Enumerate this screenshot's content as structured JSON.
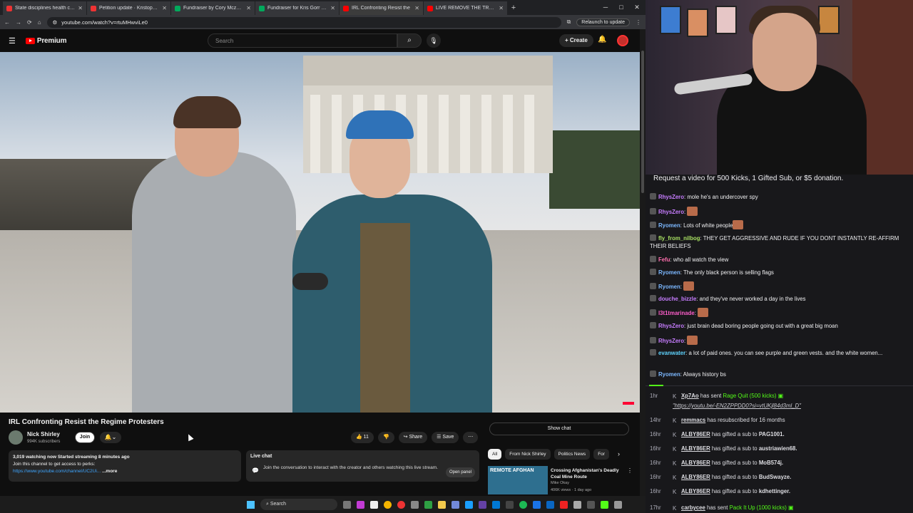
{
  "browser": {
    "tabs": [
      {
        "title": "State disciplines health care pr",
        "color": "#e33"
      },
      {
        "title": "Petition update · Kristopher's s",
        "color": "#e33"
      },
      {
        "title": "Fundraiser by Cory Mczenna : ",
        "color": "#02a95c"
      },
      {
        "title": "Fundraiser for Kris Gorr by Kel",
        "color": "#02a95c"
      },
      {
        "title": "IRL Confronting Resist the",
        "color": "#f00"
      },
      {
        "title": "LIVE REMOVE THE TRUMP REC",
        "color": "#f00"
      }
    ],
    "url": "youtube.com/watch?v=rtuMHwviLe0",
    "relaunch_label": "Relaunch to update"
  },
  "youtube": {
    "logo_text": "Premium",
    "search_placeholder": "Search",
    "create_label": "+ Create",
    "video": {
      "title": "IRL Confronting Resist the Regime Protesters",
      "channel": "Nick Shirley",
      "subscribers": "994K subscribers",
      "join_label": "Join",
      "likes": "11",
      "share_label": "Share",
      "save_label": "Save"
    },
    "description": {
      "stats": "3,019 watching now  Started streaming 8 minutes ago",
      "line2": "Join this channel to get access to perks:",
      "link": "https://www.youtube.com/channel/UC2Ui...",
      "more": "...more"
    },
    "livechat": {
      "title": "Live chat",
      "text": "Join the conversation to interact with the creator and others watching this live stream.",
      "open_label": "Open panel"
    },
    "show_chat_label": "Show chat",
    "chips": [
      "All",
      "From Nick Shirley",
      "Politics News",
      "For"
    ],
    "recommended": {
      "thumb_text": "REMOTE AFGHAN",
      "title": "Crossing Afghanistan's Deadly Coal Mine Route",
      "channel": "Mike Okay",
      "views": "406K views · 1 day ago"
    }
  },
  "taskbar": {
    "search": "Search"
  },
  "chat": {
    "pinned": "Request a video for 500 Kicks, 1 Gifted Sub, or $5 donation.",
    "messages": [
      {
        "user": "RhysZero",
        "color": "#c77dff",
        "text": "mole he's an undercover spy",
        "emote": false
      },
      {
        "user": "RhysZero",
        "color": "#c77dff",
        "text": "",
        "emote": true
      },
      {
        "user": "Ryomen",
        "color": "#7cb8ff",
        "text": "Lots of white people",
        "emote": true
      },
      {
        "user": "fly_from_nilbog",
        "color": "#a8e063",
        "text": "THEY GET AGGRESSIVE AND RUDE IF YOU DONT INSTANTLY RE-AFFIRM THEIR BELIEFS",
        "emote": false
      },
      {
        "user": "Fefu",
        "color": "#ff6fae",
        "text": "who all watch the view",
        "emote": false
      },
      {
        "user": "Ryomen",
        "color": "#7cb8ff",
        "text": "The only black person is selling flags",
        "emote": false
      },
      {
        "user": "Ryomen",
        "color": "#7cb8ff",
        "text": "",
        "emote": true
      },
      {
        "user": "douche_bizzle",
        "color": "#c77dff",
        "text": "and they've never worked a day in the lives",
        "emote": false
      },
      {
        "user": "l3t1tmarinade",
        "color": "#ff5ecb",
        "text": "",
        "emote": true
      },
      {
        "user": "RhysZero",
        "color": "#c77dff",
        "text": "just brain dead boring people going out with a great big moan",
        "emote": false
      },
      {
        "user": "RhysZero",
        "color": "#c77dff",
        "text": "",
        "emote": true
      },
      {
        "user": "evanwater",
        "color": "#5fd4ff",
        "text": "a lot of paid ones. you can see purple and green vests. and the white women...",
        "emote": false
      },
      {
        "user": "Ryomen",
        "color": "#7cb8ff",
        "text": "Always history bs",
        "emote": false
      }
    ],
    "events": [
      {
        "time": "1hr",
        "user": "Xp7Ao",
        "pre": "has sent",
        "item": "Rage Quit (500 kicks)",
        "post": "",
        "sub": "\"https://youtu.be/-EN2ZPPDD0?si=vtUKjl84d3ml_D\""
      },
      {
        "time": "14hr",
        "user": "remmacs",
        "pre": "has resubscribed for 16 months",
        "item": "",
        "post": "",
        "sub": ""
      },
      {
        "time": "16hr",
        "user": "ALBY86ER",
        "pre": "has gifted a sub to",
        "item": "",
        "post": "PAG1001.",
        "sub": ""
      },
      {
        "time": "16hr",
        "user": "ALBY86ER",
        "pre": "has gifted a sub to",
        "item": "",
        "post": "austriawien68.",
        "sub": ""
      },
      {
        "time": "16hr",
        "user": "ALBY86ER",
        "pre": "has gifted a sub to",
        "item": "",
        "post": "MoB574j.",
        "sub": ""
      },
      {
        "time": "16hr",
        "user": "ALBY86ER",
        "pre": "has gifted a sub to",
        "item": "",
        "post": "BudSwayze.",
        "sub": ""
      },
      {
        "time": "16hr",
        "user": "ALBY86ER",
        "pre": "has gifted a sub to",
        "item": "",
        "post": "kdhettinger.",
        "sub": ""
      },
      {
        "time": "17hr",
        "user": "carbycee",
        "pre": "has sent",
        "item": "Pack It Up (1000 kicks)",
        "post": "",
        "sub": ""
      }
    ]
  }
}
